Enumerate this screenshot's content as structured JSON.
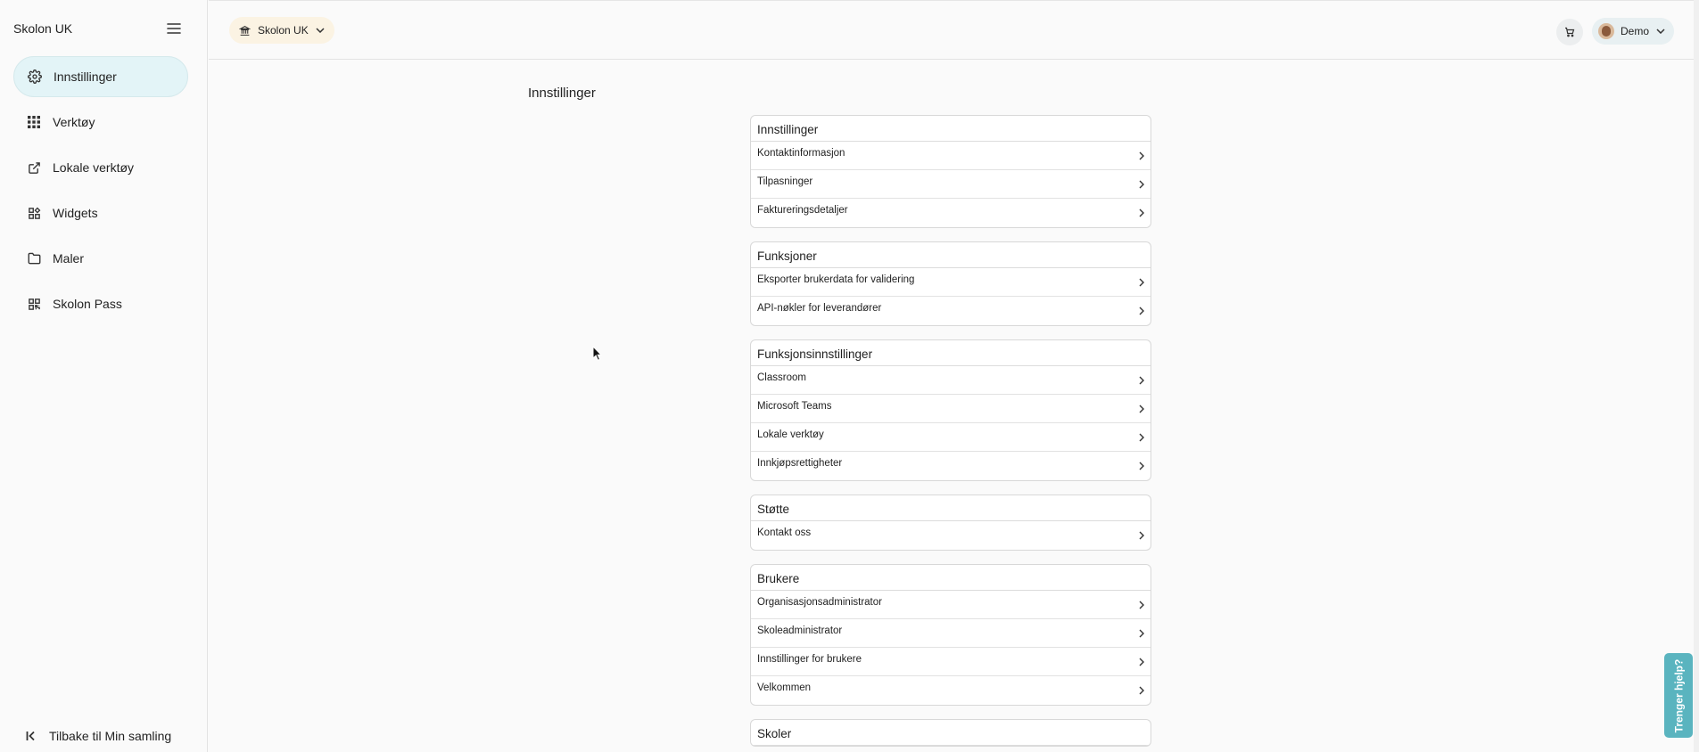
{
  "sidebar": {
    "title": "Skolon UK",
    "items": [
      {
        "label": "Innstillinger",
        "icon": "gear-icon"
      },
      {
        "label": "Verktøy",
        "icon": "grid-icon"
      },
      {
        "label": "Lokale verktøy",
        "icon": "external-link-icon"
      },
      {
        "label": "Widgets",
        "icon": "widgets-icon"
      },
      {
        "label": "Maler",
        "icon": "folder-icon"
      },
      {
        "label": "Skolon Pass",
        "icon": "qr-code-icon"
      }
    ],
    "back_label": "Tilbake til Min samling"
  },
  "topbar": {
    "org_label": "Skolon UK",
    "user_label": "Demo"
  },
  "main": {
    "title": "Innstillinger",
    "sections": [
      {
        "title": "Innstillinger",
        "items": [
          "Kontaktinformasjon",
          "Tilpasninger",
          "Faktureringsdetaljer"
        ]
      },
      {
        "title": "Funksjoner",
        "items": [
          "Eksporter brukerdata for validering",
          "API-nøkler for leverandører"
        ]
      },
      {
        "title": "Funksjonsinnstillinger",
        "items": [
          "Classroom",
          "Microsoft Teams",
          "Lokale verktøy",
          "Innkjøpsrettigheter"
        ]
      },
      {
        "title": "Støtte",
        "items": [
          "Kontakt oss"
        ]
      },
      {
        "title": "Brukere",
        "items": [
          "Organisasjonsadministrator",
          "Skoleadministrator",
          "Innstillinger for brukere",
          "Velkommen"
        ]
      },
      {
        "title": "Skoler",
        "items": []
      }
    ]
  },
  "help": {
    "label": "Trenger hjelp?"
  },
  "colors": {
    "accent": "#5ab4bf",
    "active_nav": "#e3f4f7",
    "org_chip": "#fbf3e3"
  }
}
